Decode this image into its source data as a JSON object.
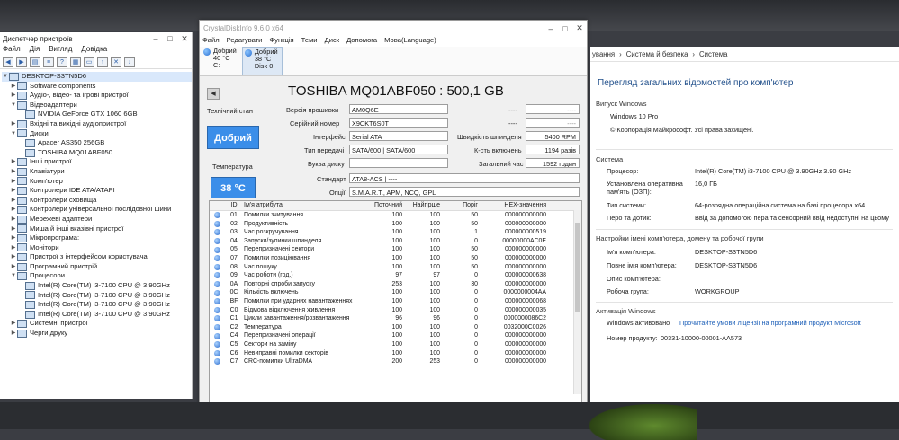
{
  "device_manager": {
    "title": "Диспетчер пристроїв",
    "menu": [
      "Файл",
      "Дія",
      "Вигляд",
      "Довідка"
    ],
    "tree": [
      {
        "level": 0,
        "expanded": true,
        "label": "DESKTOP-S3TN5D6",
        "selected": true
      },
      {
        "level": 1,
        "expanded": false,
        "label": "Software components"
      },
      {
        "level": 1,
        "expanded": false,
        "label": "Аудіо-, відео- та ігрові пристрої"
      },
      {
        "level": 1,
        "expanded": true,
        "label": "Відеоадаптери"
      },
      {
        "level": 2,
        "expanded": null,
        "label": "NVIDIA GeForce GTX 1060 6GB"
      },
      {
        "level": 1,
        "expanded": false,
        "label": "Вхідні та вихідні аудіопристрої"
      },
      {
        "level": 1,
        "expanded": true,
        "label": "Диски"
      },
      {
        "level": 2,
        "expanded": null,
        "label": "Apacer AS350 256GB"
      },
      {
        "level": 2,
        "expanded": null,
        "label": "TOSHIBA MQ01ABF050"
      },
      {
        "level": 1,
        "expanded": false,
        "label": "Інші пристрої"
      },
      {
        "level": 1,
        "expanded": false,
        "label": "Клавіатури"
      },
      {
        "level": 1,
        "expanded": false,
        "label": "Комп'ютер"
      },
      {
        "level": 1,
        "expanded": false,
        "label": "Контролери IDE ATA/ATAPI"
      },
      {
        "level": 1,
        "expanded": false,
        "label": "Контролери сховища"
      },
      {
        "level": 1,
        "expanded": false,
        "label": "Контролери універсальної послідовної шини"
      },
      {
        "level": 1,
        "expanded": false,
        "label": "Мережеві адаптери"
      },
      {
        "level": 1,
        "expanded": false,
        "label": "Миша й інші вказівні пристрої"
      },
      {
        "level": 1,
        "expanded": false,
        "label": "Мікропрограма:"
      },
      {
        "level": 1,
        "expanded": false,
        "label": "Монітори"
      },
      {
        "level": 1,
        "expanded": false,
        "label": "Пристрої з інтерфейсом користувача"
      },
      {
        "level": 1,
        "expanded": false,
        "label": "Програмний пристрій"
      },
      {
        "level": 1,
        "expanded": true,
        "label": "Процесори"
      },
      {
        "level": 2,
        "expanded": null,
        "label": "Intel(R) Core(TM) i3-7100 CPU @ 3.90GHz"
      },
      {
        "level": 2,
        "expanded": null,
        "label": "Intel(R) Core(TM) i3-7100 CPU @ 3.90GHz"
      },
      {
        "level": 2,
        "expanded": null,
        "label": "Intel(R) Core(TM) i3-7100 CPU @ 3.90GHz"
      },
      {
        "level": 2,
        "expanded": null,
        "label": "Intel(R) Core(TM) i3-7100 CPU @ 3.90GHz"
      },
      {
        "level": 1,
        "expanded": false,
        "label": "Системні пристрої"
      },
      {
        "level": 1,
        "expanded": false,
        "label": "Черги друку"
      }
    ]
  },
  "cdi": {
    "title": "CrystalDiskInfo 9.6.0 x64",
    "menu": [
      "Файл",
      "Редагувати",
      "Функція",
      "Теми",
      "Диск",
      "Допомога",
      "Мова(Language)"
    ],
    "disks": [
      {
        "status": "Добрий",
        "temp": "40 °C",
        "drive": "C:"
      },
      {
        "status": "Добрий",
        "temp": "38 °C",
        "drive": "Disk 0"
      }
    ],
    "model": "TOSHIBA MQ01ABF050 : 500,1 GB",
    "health_label": "Технічний стан",
    "health_value": "Добрий",
    "temp_label": "Температура",
    "temp_value": "38 °C",
    "firmware_label": "Версія прошивки",
    "firmware": "AM0Q6E",
    "serial_label": "Серійний номер",
    "serial": "X9CKT6S0T",
    "interface_label": "Інтерфейс",
    "interface": "Serial ATA",
    "transfer_label": "Тип передачі",
    "transfer": "SATA/600 | SATA/600",
    "letter_label": "Буква диску",
    "letter": "",
    "standard_label": "Стандарт",
    "standard": "ATA8-ACS | ----",
    "options_label": "Опції",
    "options": "S.M.A.R.T., APM, NCQ, GPL",
    "blank1": "----",
    "blank2": "----",
    "rpm_label": "Швидкість шпинделя",
    "rpm": "5400 RPM",
    "power_count_label": "К-сть включень",
    "power_count": "1194 разів",
    "hours_label": "Загальний час",
    "hours": "1592 годин",
    "columns": [
      "ID",
      "Ім'я атрибута",
      "Поточний",
      "Найгірше",
      "Поріг",
      "HEX-значення"
    ],
    "rows": [
      [
        "01",
        "Помилки зчитування",
        "100",
        "100",
        "50",
        "000000000000"
      ],
      [
        "02",
        "Продуктивність",
        "100",
        "100",
        "50",
        "000000000000"
      ],
      [
        "03",
        "Час розкручування",
        "100",
        "100",
        "1",
        "000000000519"
      ],
      [
        "04",
        "Запуски/зупинки шпинделя",
        "100",
        "100",
        "0",
        "00000000AC0E"
      ],
      [
        "05",
        "Перепризначені сектори",
        "100",
        "100",
        "50",
        "000000000000"
      ],
      [
        "07",
        "Помилки позиціювання",
        "100",
        "100",
        "50",
        "000000000000"
      ],
      [
        "08",
        "Час пошуку",
        "100",
        "100",
        "50",
        "000000000000"
      ],
      [
        "09",
        "Час роботи (год.)",
        "97",
        "97",
        "0",
        "000000000638"
      ],
      [
        "0A",
        "Повторні спроби запуску",
        "253",
        "100",
        "30",
        "000000000000"
      ],
      [
        "0C",
        "Кількість включень",
        "100",
        "100",
        "0",
        "0000000004AA"
      ],
      [
        "BF",
        "Помилки при ударних навантаженнях",
        "100",
        "100",
        "0",
        "000000000068"
      ],
      [
        "C0",
        "Відмова відключення живлення",
        "100",
        "100",
        "0",
        "000000000035"
      ],
      [
        "C1",
        "Цикли завантаження/розвантаження",
        "96",
        "96",
        "0",
        "0000000086C2"
      ],
      [
        "C2",
        "Температура",
        "100",
        "100",
        "0",
        "0032000C0026"
      ],
      [
        "C4",
        "Перепризначені операції",
        "100",
        "100",
        "0",
        "000000000000"
      ],
      [
        "C5",
        "Сектори на заміну",
        "100",
        "100",
        "0",
        "000000000000"
      ],
      [
        "C6",
        "Невиправні помилки секторів",
        "100",
        "100",
        "0",
        "000000000000"
      ],
      [
        "C7",
        "CRC-помилки UltraDMA",
        "200",
        "253",
        "0",
        "000000000000"
      ]
    ]
  },
  "system": {
    "breadcrumb": [
      "ування",
      "Система й безпека",
      "Система"
    ],
    "title": "Перегляд загальних відомостей про комп'ютер",
    "edition_header": "Випуск Windows",
    "edition": "Windows 10 Pro",
    "copyright": "© Корпорація Майкрософт. Усі права захищені.",
    "system_header": "Система",
    "processor_label": "Процесор:",
    "processor": "Intel(R) Core(TM) i3-7100 CPU @ 3.90GHz   3.90 GHz",
    "ram_label": "Установлена оперативна пам'ять (ОЗП):",
    "ram": "16,0 ГБ",
    "type_label": "Тип системи:",
    "type": "64-розрядна операційна система на базі процесора x64",
    "pen_label": "Перо та дотик:",
    "pen": "Ввід за допомогою пера та сенсорний ввід недоступні на цьому",
    "name_header": "Настройки імені комп'ютера, домену та робочої групи",
    "pc_name_label": "Ім'я комп'ютера:",
    "pc_name": "DESKTOP-S3TN5D6",
    "full_name_label": "Повне ім'я комп'ютера:",
    "full_name": "DESKTOP-S3TN5D6",
    "desc_label": "Опис комп'ютера:",
    "workgroup_label": "Робоча група:",
    "workgroup": "WORKGROUP",
    "activation_header": "Активація Windows",
    "activated": "Windows активовано",
    "license_link": "Прочитайте умови ліцензії на програмний продукт Microsoft",
    "product_id_label": "Номер продукту:",
    "product_id": "00331-10000-00001-AA573"
  }
}
